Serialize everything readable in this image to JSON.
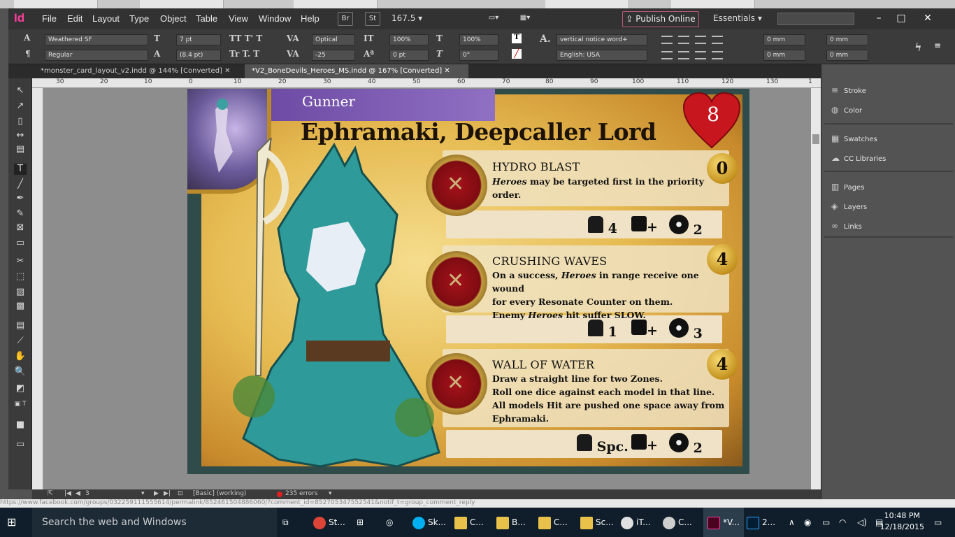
{
  "app": {
    "logo": "Id",
    "menus": [
      "File",
      "Edit",
      "Layout",
      "Type",
      "Object",
      "Table",
      "View",
      "Window",
      "Help"
    ],
    "bridge_label": "Br",
    "stock_label": "St",
    "zoom": "167.5",
    "publish_label": "Publish Online",
    "workspace_label": "Essentials",
    "search_placeholder": ""
  },
  "control": {
    "font_family": "Weathered SF",
    "font_style": "Regular",
    "font_size": "7 pt",
    "leading": "(8.4 pt)",
    "kerning": "Optical",
    "tracking": "-25",
    "vscale": "100%",
    "hscale": "100%",
    "baseline": "0 pt",
    "skew": "0°",
    "char_style": "vertical notice word+",
    "language": "English: USA",
    "indent_left": "0 mm",
    "indent_right": "0 mm",
    "space_before": "0 mm",
    "space_after": "0 mm"
  },
  "tabs": [
    {
      "label": "*monster_card_layout_v2.indd @ 144% [Converted]"
    },
    {
      "label": "*V2_BoneDevils_Heroes_MS.indd @ 167% [Converted]"
    }
  ],
  "ruler_ticks": [
    "30",
    "20",
    "10",
    "0",
    "10",
    "20",
    "30",
    "40",
    "50",
    "60",
    "70",
    "80",
    "90",
    "100",
    "110",
    "120",
    "130",
    "1"
  ],
  "card": {
    "type": "Gunner",
    "name": "Ephramaki, Deepcaller Lord",
    "health": "8",
    "abilities": [
      {
        "title": "HYDRO BLAST",
        "lines": [
          {
            "em": "Heroes",
            "text": " may be targeted first in the priority order."
          }
        ],
        "cost": "0",
        "fig_val": "4",
        "die_suffix": "+",
        "burst_val": "2"
      },
      {
        "title": "CRUSHING WAVES",
        "lines": [
          {
            "pre": "On a success, ",
            "em": "Heroes",
            "text": " in range receive one wound"
          },
          {
            "text": "for every Resonate Counter on them."
          },
          {
            "pre": "Enemy ",
            "em": "Heroes",
            "text": " hit suffer SLOW."
          }
        ],
        "cost": "4",
        "fig_val": "1",
        "die_suffix": "+",
        "burst_val": "3"
      },
      {
        "title": "WALL OF WATER",
        "lines": [
          {
            "text": "Draw a straight line for two Zones."
          },
          {
            "text": "Roll one dice against each model in that line."
          },
          {
            "text": "All models Hit are pushed one space away from"
          },
          {
            "text": "Ephramaki."
          }
        ],
        "cost": "4",
        "fig_val": "Spc.",
        "die_suffix": "+",
        "burst_val": "2"
      }
    ]
  },
  "doc_status": {
    "page": "3",
    "style": "[Basic] (working)",
    "errors": "235 errors"
  },
  "panels": [
    {
      "label": "Stroke",
      "icon": "stroke-icon"
    },
    {
      "label": "Color",
      "icon": "color-icon"
    },
    {
      "label": "Swatches",
      "icon": "swatches-icon"
    },
    {
      "label": "CC Libraries",
      "icon": "cc-libraries-icon"
    },
    {
      "label": "Pages",
      "icon": "pages-icon"
    },
    {
      "label": "Layers",
      "icon": "layers-icon"
    },
    {
      "label": "Links",
      "icon": "links-icon"
    }
  ],
  "taskbar": {
    "search_placeholder": "Search the web and Windows",
    "apps": [
      {
        "label": "St...",
        "color": "#db4437"
      },
      {
        "label": "Sk...",
        "color": "#00aff0"
      },
      {
        "label": "C...",
        "color": "#e8c14a"
      },
      {
        "label": "B...",
        "color": "#e8c14a"
      },
      {
        "label": "C...",
        "color": "#e8c14a"
      },
      {
        "label": "Sc...",
        "color": "#e8c14a"
      },
      {
        "label": "iT...",
        "color": "#e0e0e0"
      },
      {
        "label": "C...",
        "color": "#cfcfcf"
      },
      {
        "label": "*V...",
        "color": "#ff3d9c"
      },
      {
        "label": "2...",
        "color": "#31a8ff"
      }
    ],
    "time": "10:48 PM",
    "date": "12/18/2015"
  },
  "url_text": "https://www.facebook.com/groups/032259111555614/permalink/852461504886060/?comment_id=852705347552541&notif_t=group_comment_reply"
}
